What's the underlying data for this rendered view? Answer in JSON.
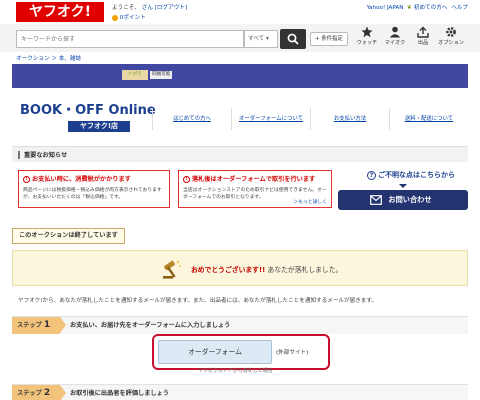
{
  "header": {
    "logo_text": "ヤフオク!",
    "welcome_text": "ようこそ、",
    "welcome_suffix": "さん [ログアウト]",
    "points_text": "0ポイント",
    "top_links": [
      "Yahoo! JAPAN",
      "初めての方へ",
      "ヘルプ"
    ]
  },
  "search": {
    "placeholder": "キーワードから探す",
    "scope_value": "すべて ▾",
    "condition_label": "+ 条件指定"
  },
  "icon_nav": [
    {
      "label": "ウォッチ",
      "icon": "star-icon"
    },
    {
      "label": "マイオク",
      "icon": "person-icon"
    },
    {
      "label": "出品",
      "icon": "upload-icon"
    },
    {
      "label": "オプション",
      "icon": "gear-icon"
    }
  ],
  "breadcrumb": "オークション ＞ 本、雑誌",
  "banner": {
    "image_text": "ヘポタ",
    "tag": "同梱可能"
  },
  "store": {
    "logo_main": "BOOK・OFF Online",
    "logo_sub": "ヤフオク!店",
    "nav": [
      "はじめての方へ",
      "オーダーフォームについて",
      "お支払い方法",
      "送料・配送について"
    ]
  },
  "notice": {
    "title": "重要なお知らせ",
    "alerts": [
      {
        "title": "お支払い時に、消費税がかかります",
        "body": "商品ページには税抜価格・税込み価格が両方表示されておりますが、お支払いいただくのは「税込価格」です。"
      },
      {
        "title": "落札後はオーダーフォームで取引を行います",
        "body": "当店はオークションストアのため取引ナビは使用できません。オーダーフォームでのお取引となります。",
        "more": "＞もっと詳しく"
      }
    ],
    "help_title": "ご不明な点はこちらから",
    "contact_label": "お問い合わせ"
  },
  "status": {
    "ended_label": "このオークションは終了しています",
    "congrats_prefix": "おめでとうございます!!",
    "congrats_suffix": "あなたが落札しました。",
    "notify_text": "ヤフオク!から、あなたが落札したことを通知するメールが届きます。また、出品者には、あなたが落札したことを通知するメールが届きます。"
  },
  "steps": [
    {
      "badge_word": "ステップ",
      "number": "1",
      "text": "お支払い、お届け先をオーダーフォームに入力しましょう"
    },
    {
      "badge_word": "ステップ",
      "number": "2",
      "text": "お取引後に出品者を評価しましょう"
    }
  ],
  "order": {
    "button_label": "オーダーフォーム",
    "external_note": "(外部サイト)",
    "store_link": "ヤフオクストアから落札した場合"
  },
  "colors": {
    "brand_red": "#e00000",
    "banner_navy": "#4048a2",
    "alert_red": "#d40000",
    "step_orange": "#f2c37b",
    "highlight_red": "#c8102e"
  }
}
